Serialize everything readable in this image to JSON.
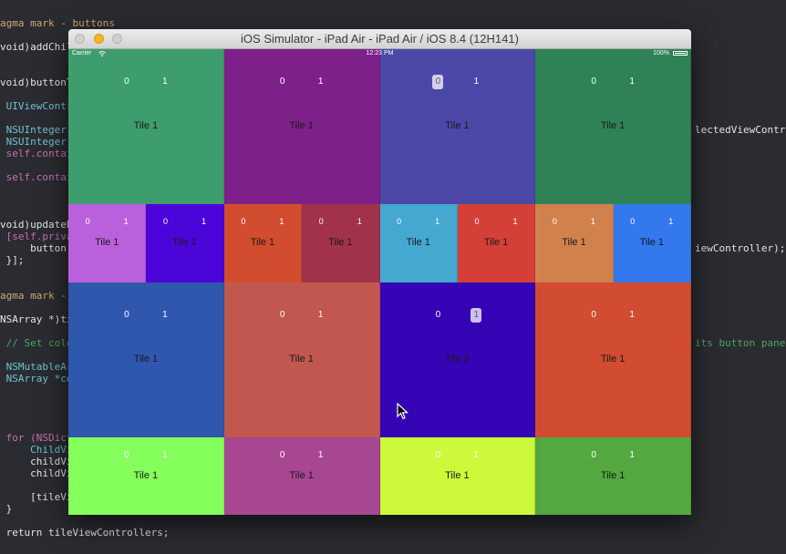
{
  "code": {
    "lines": [
      {
        "text": "agma mark - buttons",
        "color": "#d0a872"
      },
      {
        "text": "void)addChil",
        "color": "#e4e4e4"
      },
      {
        "text": "void)buttonT",
        "color": "#e4e4e4"
      },
      {
        "text": " UIViewContro",
        "color": "#6ec3d4"
      },
      {
        "text": " NSUInteger",
        "color": "#6ec3d4"
      },
      {
        "text": " NSUInteger",
        "color": "#6ec3d4"
      },
      {
        "text": " self.contai",
        "color": "#c86fb5"
      },
      {
        "text": " self.contai",
        "color": "#c86fb5"
      },
      {
        "text": "void)updateB",
        "color": "#e4e4e4"
      },
      {
        "text": " [self.priva",
        "color": "#c86fb5"
      },
      {
        "text": "     button.",
        "color": "#e4e4e4"
      },
      {
        "text": " }];",
        "color": "#e4e4e4"
      },
      {
        "text": "agma mark - ",
        "color": "#d0a872"
      },
      {
        "text": "NSArray *)ti",
        "color": "#e4e4e4"
      },
      {
        "text": " // Set colo",
        "color": "#4fa35f"
      },
      {
        "text": " NSMutableAr",
        "color": "#6ec3d4"
      },
      {
        "text": " NSArray *co",
        "color": "#6ec3d4"
      },
      {
        "text": " for (NSDict",
        "color": "#c86fb5"
      },
      {
        "text": "     ChildVi",
        "color": "#6ec3d4"
      },
      {
        "text": "     childVi",
        "color": "#e4e4e4"
      },
      {
        "text": "     childVi",
        "color": "#e4e4e4"
      },
      {
        "text": "     [tileVi",
        "color": "#e4e4e4"
      },
      {
        "text": " }",
        "color": "#e4e4e4"
      },
      {
        "text": " return tileViewControllers;",
        "color": "#e4e4e4"
      }
    ],
    "right": [
      {
        "text": "lectedViewContro",
        "color": "#e4e4e4"
      },
      {
        "text": "iewController);",
        "color": "#e4e4e4"
      },
      {
        "text": "its button pane.",
        "color": "#4fa35f"
      }
    ]
  },
  "window": {
    "title": "iOS Simulator - iPad Air - iPad Air / iOS 8.4 (12H141)",
    "controls": {
      "close_color": "#d0d0d0",
      "minimize_color": "#f4b624",
      "zoom_color": "#d0d0d0"
    }
  },
  "statusbar": {
    "carrier": "Carrier",
    "time": "12:23 PM",
    "battery": "100%"
  },
  "tiles": [
    {
      "label": "Tile 1",
      "color": "#3e9d6c",
      "selected": null
    },
    {
      "label": "Tile 1",
      "color": "#7d2089",
      "selected": null
    },
    {
      "label": "Tile 1",
      "color": "#4b48a8",
      "selected": 0
    },
    {
      "label": "Tile 1",
      "color": "#2f8256",
      "selected": null
    },
    {
      "label": "Tile 1",
      "color": "#bb60dc",
      "selected": null
    },
    {
      "label": "Tile 1",
      "color": "#4b05d8",
      "selected": null
    },
    {
      "label": "Tile 1",
      "color": "#d24d2f",
      "selected": null
    },
    {
      "label": "Tile 1",
      "color": "#a23249",
      "selected": null
    },
    {
      "label": "Tile 1",
      "color": "#44a8d0",
      "selected": null
    },
    {
      "label": "Tile 1",
      "color": "#d44037",
      "selected": null
    },
    {
      "label": "Tile 1",
      "color": "#d1824c",
      "selected": null
    },
    {
      "label": "Tile 1",
      "color": "#3478ee",
      "selected": null
    },
    {
      "label": "Tile 1",
      "color": "#3057ae",
      "selected": null
    },
    {
      "label": "Tile 1",
      "color": "#c1574f",
      "selected": null
    },
    {
      "label": "Tile 2",
      "color": "#3504b4",
      "selected": 1
    },
    {
      "label": "Tile 1",
      "color": "#d14c30",
      "selected": null
    },
    {
      "label": "Tile 1",
      "color": "#85ff5c",
      "selected": null
    },
    {
      "label": "Tile 1",
      "color": "#a74691",
      "selected": null
    },
    {
      "label": "Tile 1",
      "color": "#ccf93a",
      "selected": null
    },
    {
      "label": "Tile 1",
      "color": "#53a83f",
      "selected": null
    }
  ],
  "tile_buttons": [
    "0",
    "1"
  ],
  "icons": {
    "wifi": "wifi-icon",
    "battery": "battery-icon",
    "cursor": "mouse-pointer-icon"
  }
}
